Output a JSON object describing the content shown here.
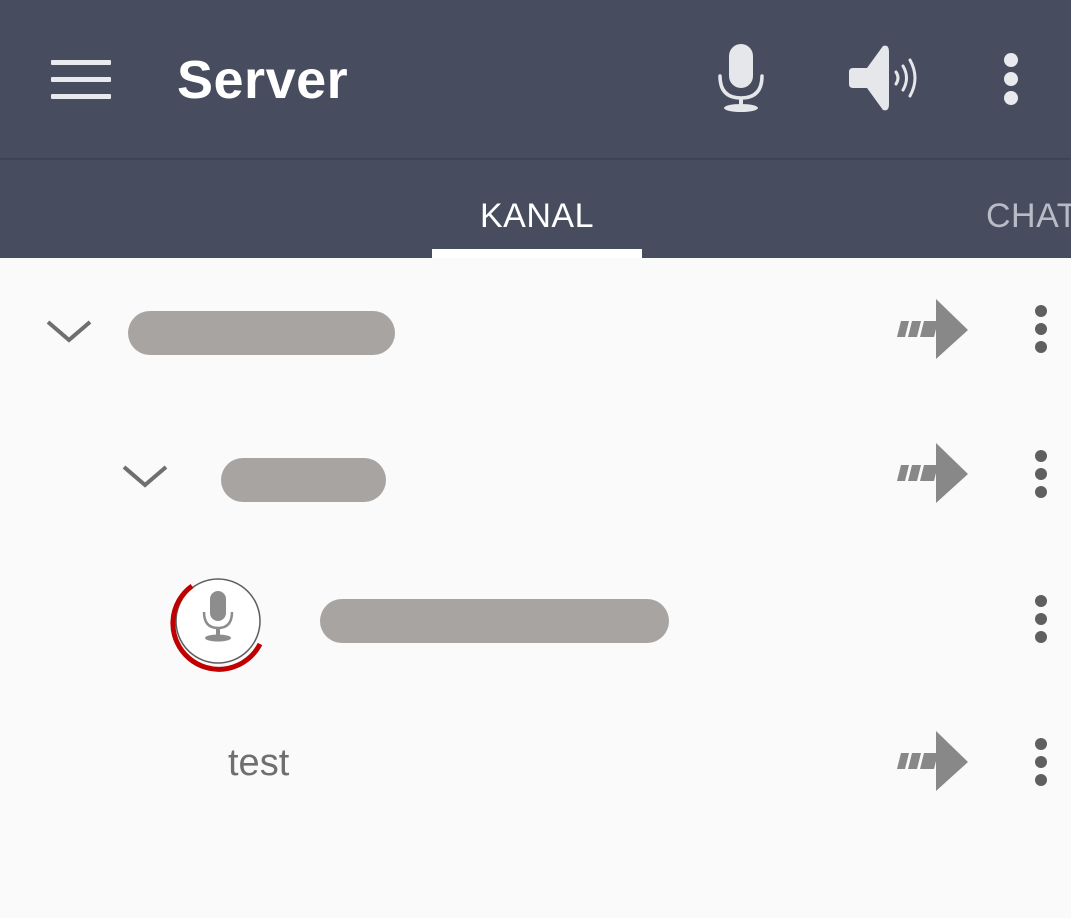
{
  "appbar": {
    "title": "Server",
    "menu_icon": "hamburger-menu-icon",
    "mic_icon": "microphone-icon",
    "speaker_icon": "speaker-volume-icon",
    "overflow_icon": "more-vert-icon",
    "background_color": "#474d5e"
  },
  "tabs": [
    {
      "label": "KANAL",
      "active": true
    },
    {
      "label": "CHAT",
      "active": false
    }
  ],
  "channel_tree": [
    {
      "type": "channel",
      "name": "",
      "name_redacted": true,
      "expanded": true,
      "icons": [
        "chevron-down-icon",
        "join-channel-arrow-icon",
        "more-vert-icon"
      ]
    },
    {
      "type": "channel",
      "name": "",
      "name_redacted": true,
      "expanded": true,
      "icons": [
        "chevron-down-icon",
        "join-channel-arrow-icon",
        "more-vert-icon"
      ]
    },
    {
      "type": "client",
      "name": "",
      "name_redacted": true,
      "icons": [
        "talking-microphone-icon",
        "more-vert-icon"
      ],
      "status_ring_color": "#c00000"
    },
    {
      "type": "channel",
      "name": "test",
      "icons": [
        "join-channel-arrow-icon",
        "more-vert-icon"
      ]
    }
  ]
}
